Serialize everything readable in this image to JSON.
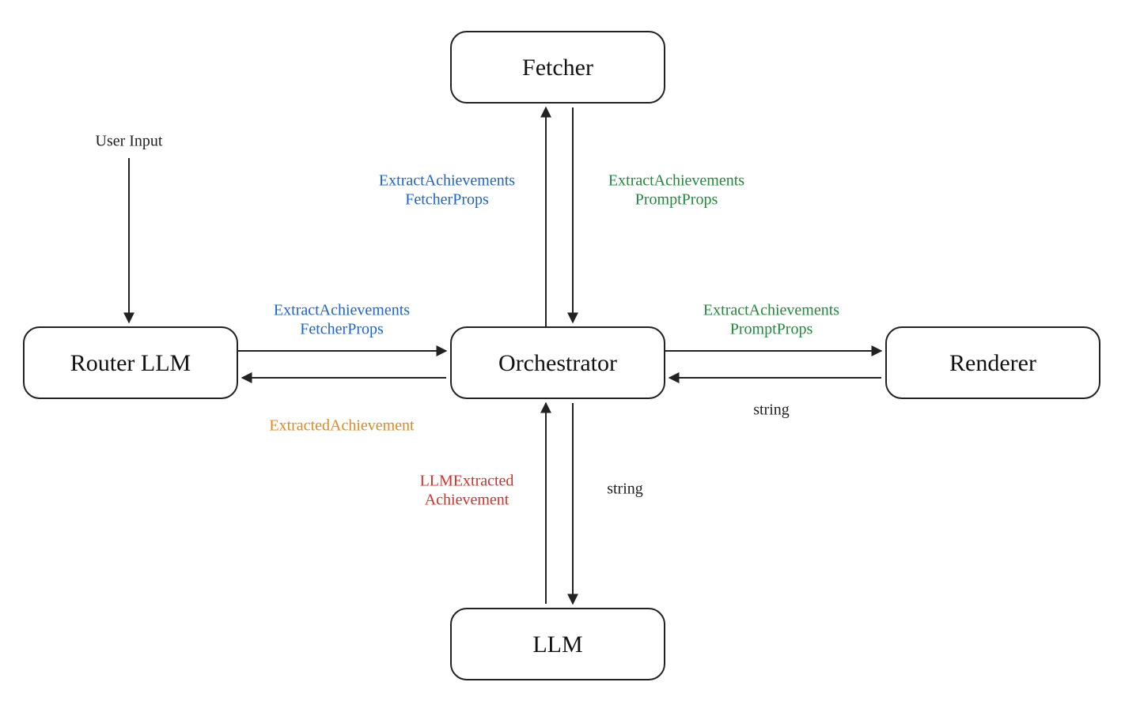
{
  "nodes": {
    "fetcher": {
      "label": "Fetcher"
    },
    "routerLLM": {
      "label": "Router LLM"
    },
    "orchestrator": {
      "label": "Orchestrator"
    },
    "renderer": {
      "label": "Renderer"
    },
    "llm": {
      "label": "LLM"
    }
  },
  "externalInput": {
    "label": "User Input"
  },
  "edges": {
    "routerToOrch_top": {
      "line1": "ExtractAchievements",
      "line2": "FetcherProps",
      "color": "blue"
    },
    "orchToRouter_bottom": {
      "line1": "ExtractedAchievement",
      "color": "orange"
    },
    "orchToFetcher_left": {
      "line1": "ExtractAchievements",
      "line2": "FetcherProps",
      "color": "blue"
    },
    "fetcherToOrch_right": {
      "line1": "ExtractAchievements",
      "line2": "PromptProps",
      "color": "green"
    },
    "orchToRenderer_top": {
      "line1": "ExtractAchievements",
      "line2": "PromptProps",
      "color": "green"
    },
    "rendererToOrch_bot": {
      "line1": "string",
      "color": "black"
    },
    "llmToOrch_left": {
      "line1": "LLMExtracted",
      "line2": "Achievement",
      "color": "red"
    },
    "orchToLLM_right": {
      "line1": "string",
      "color": "black"
    }
  }
}
